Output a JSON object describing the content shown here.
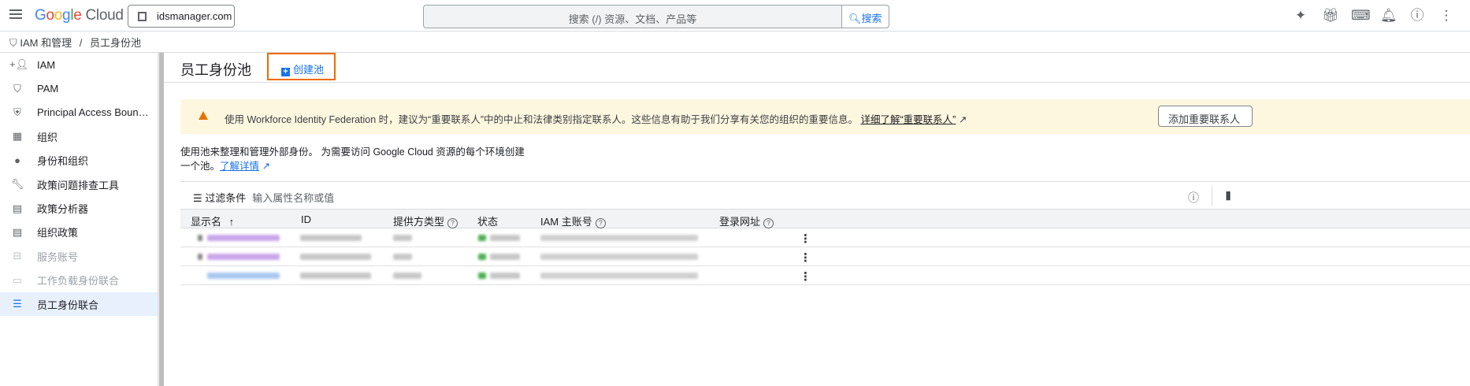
{
  "topbar": {
    "brand": "Google Cloud",
    "project": "idsmanager.com",
    "search_placeholder": "搜索 (/) 资源、文档、产品等",
    "search_button": "搜索"
  },
  "breadcrumb": {
    "parent": "IAM 和管理",
    "sep": "/",
    "current": "员工身份池"
  },
  "sidebar": {
    "items": [
      {
        "label": "IAM",
        "icon": "person-add-icon"
      },
      {
        "label": "PAM",
        "icon": "shield-icon"
      },
      {
        "label": "Principal Access Boun…",
        "icon": "policy-icon"
      },
      {
        "label": "组织",
        "icon": "building-icon"
      },
      {
        "label": "身份和组织",
        "icon": "account-circle-icon"
      },
      {
        "label": "政策问题排查工具",
        "icon": "wrench-icon"
      },
      {
        "label": "政策分析器",
        "icon": "document-search-icon"
      },
      {
        "label": "组织政策",
        "icon": "list-doc-icon"
      },
      {
        "label": "服务账号",
        "icon": "service-account-icon"
      },
      {
        "label": "工作负载身份联合",
        "icon": "workload-icon"
      },
      {
        "label": "员工身份联合",
        "icon": "list-icon"
      }
    ]
  },
  "page": {
    "title": "员工身份池",
    "create_button": "创建池"
  },
  "banner": {
    "text": "使用 Workforce Identity Federation 时，建议为“重要联系人”中的中止和法律类别指定联系人。这些信息有助于我们分享有关您的组织的重要信息。",
    "link": "详细了解“重要联系人”",
    "button": "添加重要联系人"
  },
  "description": {
    "text": "使用池来整理和管理外部身份。 为需要访问 Google Cloud 资源的每个环境创建一个池。",
    "link": "了解详情"
  },
  "filter": {
    "label": "过滤条件",
    "placeholder": "输入属性名称或值"
  },
  "table": {
    "columns": [
      "显示名",
      "ID",
      "提供方类型",
      "状态",
      "IAM 主账号",
      "登录网址"
    ],
    "sort_arrow": "↑",
    "row_count": 3
  },
  "colors": {
    "accent": "#1a73e8",
    "highlight": "#f06a00",
    "warning": "#e37400"
  }
}
